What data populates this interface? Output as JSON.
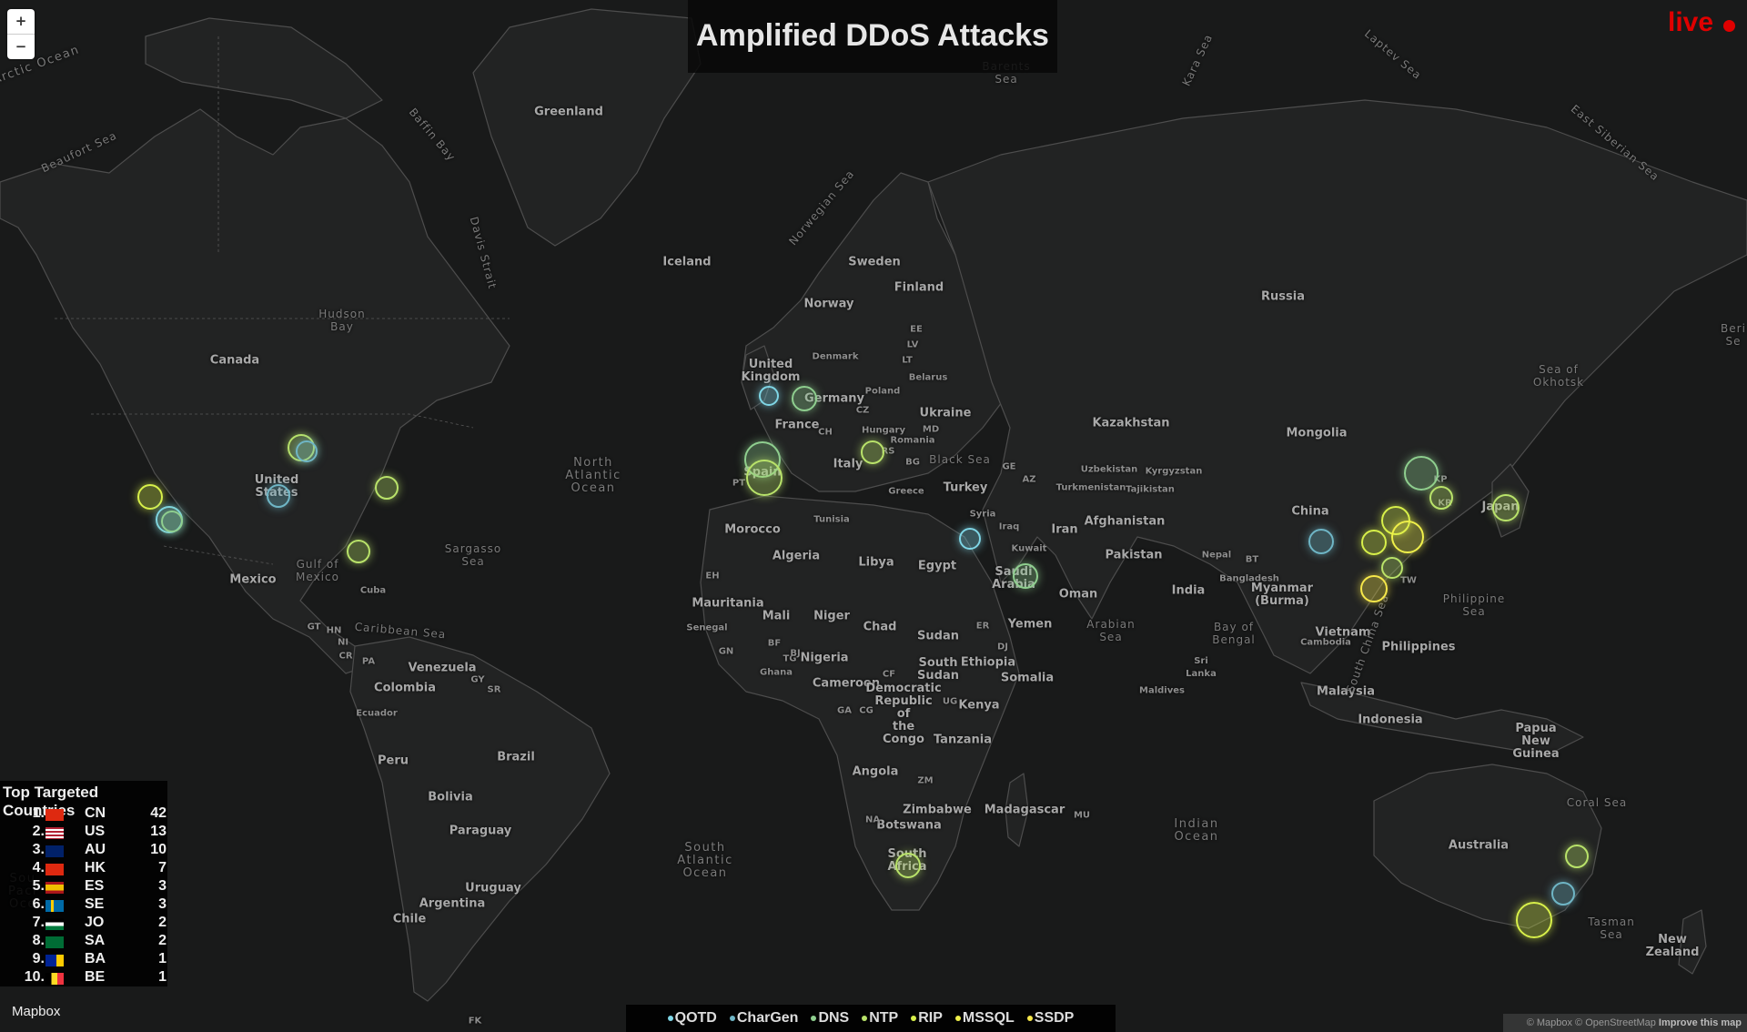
{
  "title": "Amplified DDoS Attacks",
  "live_label": "live",
  "colors": {
    "background": "#191a1a",
    "land": "#222323",
    "border": "#4a4a4a",
    "live": "#e00000",
    "QOTD": "#7fd6e6",
    "ChargGen": "#6fb6c6",
    "DNS": "#8fcf8f",
    "NTP": "#b9e36a",
    "RIP": "#d8f04a",
    "MSSQL": "#f0f04a",
    "SSDP": "#f7e84a"
  },
  "zoom": {
    "in_label": "+",
    "out_label": "−"
  },
  "top_countries": {
    "header": "Top Targeted Countries",
    "rows": [
      {
        "rank": "1.",
        "flag": "cn",
        "code": "CN",
        "count": "42"
      },
      {
        "rank": "2.",
        "flag": "us",
        "code": "US",
        "count": "13"
      },
      {
        "rank": "3.",
        "flag": "au",
        "code": "AU",
        "count": "10"
      },
      {
        "rank": "4.",
        "flag": "hk",
        "code": "HK",
        "count": "7"
      },
      {
        "rank": "5.",
        "flag": "es",
        "code": "ES",
        "count": "3"
      },
      {
        "rank": "6.",
        "flag": "se",
        "code": "SE",
        "count": "3"
      },
      {
        "rank": "7.",
        "flag": "jo",
        "code": "JO",
        "count": "2"
      },
      {
        "rank": "8.",
        "flag": "sa",
        "code": "SA",
        "count": "2"
      },
      {
        "rank": "9.",
        "flag": "ba",
        "code": "BA",
        "count": "1"
      },
      {
        "rank": "10.",
        "flag": "be",
        "code": "BE",
        "count": "1"
      }
    ]
  },
  "legend": [
    "QOTD",
    "CharGen",
    "DNS",
    "NTP",
    "RIP",
    "MSSQL",
    "SSDP"
  ],
  "mapbox_logo": "Mapbox",
  "attribution": {
    "text": "© Mapbox © OpenStreetMap",
    "improve": "Improve this map"
  },
  "map_labels": {
    "countries": [
      "Canada",
      "United States",
      "Mexico",
      "Cuba",
      "Venezuela",
      "Colombia",
      "Ecuador",
      "Peru",
      "Brazil",
      "Bolivia",
      "Paraguay",
      "Uruguay",
      "Argentina",
      "Chile",
      "Greenland",
      "Iceland",
      "Norway",
      "Sweden",
      "Finland",
      "Denmark",
      "United Kingdom",
      "France",
      "Spain",
      "Germany",
      "Poland",
      "Belarus",
      "Ukraine",
      "Italy",
      "Hungary",
      "Romania",
      "Greece",
      "Turkey",
      "Russia",
      "Kazakhstan",
      "Mongolia",
      "China",
      "Japan",
      "Morocco",
      "Algeria",
      "Libya",
      "Egypt",
      "Tunisia",
      "Mauritania",
      "Mali",
      "Niger",
      "Chad",
      "Sudan",
      "Nigeria",
      "Cameroon",
      "Ethiopia",
      "Somalia",
      "Kenya",
      "Tanzania",
      "Angola",
      "Zimbabwe",
      "Botswana",
      "South Africa",
      "Madagascar",
      "Saudi Arabia",
      "Iran",
      "Iraq",
      "Syria",
      "Kuwait",
      "Oman",
      "Yemen",
      "Afghanistan",
      "Pakistan",
      "India",
      "Nepal",
      "Bangladesh",
      "Myanmar (Burma)",
      "Vietnam",
      "Cambodia",
      "Philippines",
      "Malaysia",
      "Indonesia",
      "Australia",
      "New Zealand",
      "Papua New Guinea",
      "Uzbekistan",
      "Kyrgyzstan",
      "Turkmenistan",
      "Tajikistan",
      "Sri Lanka",
      "Maldives",
      "Senegal",
      "Ghana",
      "South Sudan",
      "Democratic Republic of the Congo"
    ],
    "waters": [
      "Arctic Ocean",
      "Beaufort Sea",
      "Baffin Bay",
      "Davis Strait",
      "Hudson Bay",
      "Norwegian Sea",
      "Barents Sea",
      "Kara Sea",
      "Laptev Sea",
      "East Siberian Sea",
      "Bering Sea",
      "Sea of Okhotsk",
      "North Atlantic Ocean",
      "Sargasso Sea",
      "Gulf of Mexico",
      "Caribbean Sea",
      "South Atlantic Ocean",
      "Black Sea",
      "Arabian Sea",
      "Bay of Bengal",
      "Indian Ocean",
      "South China Sea",
      "Philippine Sea",
      "Coral Sea",
      "Tasman Sea",
      "South Pacific Ocean"
    ],
    "small": [
      "EE",
      "LV",
      "LT",
      "CZ",
      "MD",
      "BG",
      "RS",
      "CH",
      "PT",
      "GE",
      "AZ",
      "KP",
      "KR",
      "TW",
      "BT",
      "EH",
      "GN",
      "BF",
      "TG",
      "BJ",
      "CF",
      "CG",
      "GA",
      "UG",
      "ZM",
      "NA",
      "ER",
      "DJ",
      "MU",
      "GT",
      "HN",
      "NI",
      "CR",
      "PA",
      "GY",
      "SR",
      "FK"
    ]
  }
}
